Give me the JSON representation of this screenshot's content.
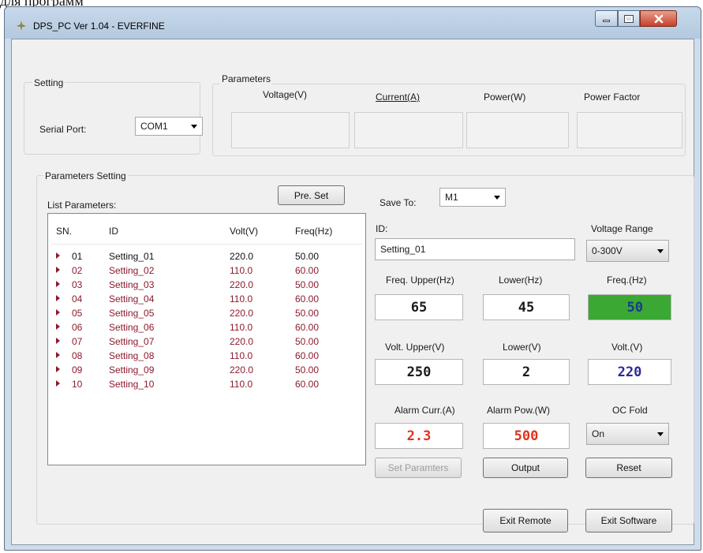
{
  "caption": "для программ",
  "window": {
    "title": "DPS_PC Ver 1.04 - EVERFINE"
  },
  "setting": {
    "group_label": "Setting",
    "serial_label": "Serial Port:",
    "serial_value": "COM1"
  },
  "parameters": {
    "group_label": "Parameters",
    "voltage": "Voltage(V)",
    "current": "Current(A)",
    "power": "Power(W)",
    "pf": "Power Factor"
  },
  "param_setting": {
    "group_label": "Parameters Setting",
    "list_label": "List Parameters:",
    "preset_button": "Pre. Set",
    "columns": {
      "sn": "SN.",
      "id": "ID",
      "volt": "Volt(V)",
      "freq": "Freq(Hz)"
    },
    "rows": [
      {
        "sn": "01",
        "id": "Setting_01",
        "volt": "220.0",
        "freq": "50.00"
      },
      {
        "sn": "02",
        "id": "Setting_02",
        "volt": "110.0",
        "freq": "60.00"
      },
      {
        "sn": "03",
        "id": "Setting_03",
        "volt": "220.0",
        "freq": "50.00"
      },
      {
        "sn": "04",
        "id": "Setting_04",
        "volt": "110.0",
        "freq": "60.00"
      },
      {
        "sn": "05",
        "id": "Setting_05",
        "volt": "220.0",
        "freq": "50.00"
      },
      {
        "sn": "06",
        "id": "Setting_06",
        "volt": "110.0",
        "freq": "60.00"
      },
      {
        "sn": "07",
        "id": "Setting_07",
        "volt": "220.0",
        "freq": "50.00"
      },
      {
        "sn": "08",
        "id": "Setting_08",
        "volt": "110.0",
        "freq": "60.00"
      },
      {
        "sn": "09",
        "id": "Setting_09",
        "volt": "220.0",
        "freq": "50.00"
      },
      {
        "sn": "10",
        "id": "Setting_10",
        "volt": "110.0",
        "freq": "60.00"
      }
    ],
    "save_to_label": "Save To:",
    "save_to_value": "M1",
    "id_label": "ID:",
    "id_value": "Setting_01",
    "vrange_label": "Voltage Range",
    "vrange_value": "0-300V",
    "freq_upper_label": "Freq. Upper(Hz)",
    "freq_lower_label": "Lower(Hz)",
    "freq_label": "Freq.(Hz)",
    "freq_upper": "65",
    "freq_lower": "45",
    "freq": "50",
    "volt_upper_label": "Volt. Upper(V)",
    "volt_lower_label": "Lower(V)",
    "volt_label": "Volt.(V)",
    "volt_upper": "250",
    "volt_lower": "2",
    "volt": "220",
    "alarm_curr_label": "Alarm Curr.(A)",
    "alarm_pow_label": "Alarm Pow.(W)",
    "ocfold_label": "OC Fold",
    "alarm_curr": "2.3",
    "alarm_pow": "500",
    "ocfold_value": "On",
    "set_params_button": "Set Paramters",
    "output_button": "Output",
    "reset_button": "Reset"
  },
  "footer": {
    "exit_remote": "Exit Remote",
    "exit_software": "Exit Software"
  },
  "colors": {
    "red_value": "#e0321c",
    "blue_value": "#2a2a9a",
    "freq_highlight": "#3aa832",
    "list_text": "#8b1a2c"
  }
}
